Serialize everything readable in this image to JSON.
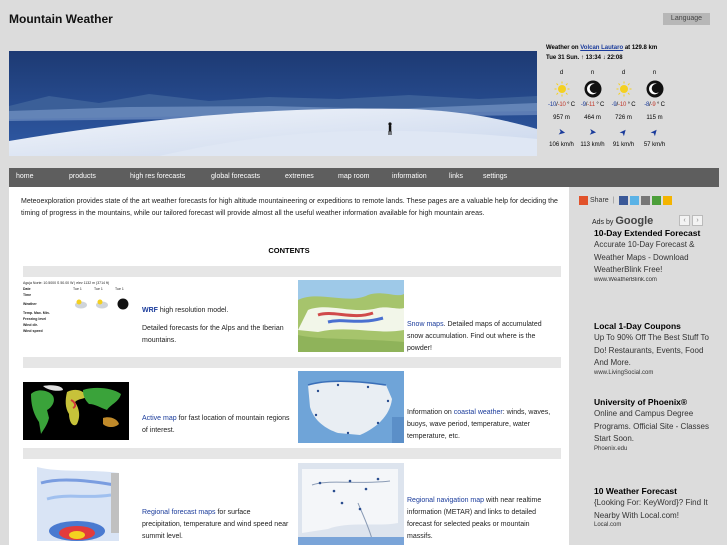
{
  "header": {
    "site_title": "Mountain Weather",
    "language_button": "Language"
  },
  "weather": {
    "title_prefix": "Weather on",
    "location": "Volcan Lautaro",
    "distance": "at 129.8 km",
    "date_line": "Tue 31  Sun. ↑ 13:34 ↓ 22:08",
    "columns": [
      {
        "period": "d",
        "icon": "sun-icon",
        "t_lo": "-10",
        "t_hi": "-10",
        "unit": "° C",
        "alt": "957 m",
        "wind": "106 km/h",
        "arrow": "➤"
      },
      {
        "period": "n",
        "icon": "moon-icon",
        "t_lo": "-9",
        "t_hi": "-11",
        "unit": "° C",
        "alt": "464 m",
        "wind": "113 km/h",
        "arrow": "➤"
      },
      {
        "period": "d",
        "icon": "sun-icon",
        "t_lo": "-9",
        "t_hi": "-10",
        "unit": "° C",
        "alt": "726 m",
        "wind": "91 km/h",
        "arrow": "➤"
      },
      {
        "period": "n",
        "icon": "moon-icon",
        "t_lo": "-8",
        "t_hi": "-9",
        "unit": "° C",
        "alt": "115 m",
        "wind": "57 km/h",
        "arrow": "➤"
      }
    ]
  },
  "nav": {
    "items": [
      "home",
      "products",
      "high res forecasts",
      "global forecasts",
      "extremes",
      "map room",
      "information",
      "links",
      "settings"
    ]
  },
  "main": {
    "intro": "Meteoexploration provides state of the art weather forecasts for high altitude mountaineering or expeditions to remote lands. These pages are a valuable help for deciding the timing of progress in the mountains, while our tailored forecast will provide almost all the useful weather information available for high mountain areas.",
    "contents_heading": "CONTENTS",
    "wrf_table": {
      "header": "Aguja Norte: 10.5000 S 50.00 W | elev 1132 m (3714 ft)",
      "date_label": "Date",
      "time_label": "Time",
      "weather_label": "Weather",
      "temp_label": "Temp. Max. Min.",
      "pressure_label": "Freezing level",
      "wind_dir_label": "Wind dir.",
      "wind_speed_label": "Wind speed",
      "cols": [
        "Tue 1",
        "Tue 1",
        "Tue 1"
      ]
    },
    "items": [
      {
        "link": "WRF",
        "text_after_link": " high resolution model.",
        "text2": "Detailed forecasts for the Alps and the Iberian mountains."
      },
      {
        "link": "Snow maps",
        "text_after_link": ". Detailed maps of accumulated snow accumulation. Find out where is the powder!"
      },
      {
        "link": "Active map",
        "text_after_link": " for fast location of mountain regions of interest."
      },
      {
        "text_before_link": "Information on ",
        "link": "coastal weather",
        "text_after_link": ": winds, waves, buoys, wave period, temperature, water temperature, etc."
      },
      {
        "link": "Regional forecast maps",
        "text_after_link": " for surface precipitation, temperature and wind speed near summit level."
      },
      {
        "link": "Regional navigation map",
        "text_after_link": " with near realtime information (METAR) and links to detailed forecast for selected peaks or mountain massifs."
      }
    ]
  },
  "sidebar": {
    "share_label": "Share",
    "ads_by": "Ads by",
    "ads_brand": "Google",
    "ads": [
      {
        "title": "10-Day Extended Forecast",
        "body": "Accurate 10-Day Forecast & Weather Maps - Download WeatherBlink Free!",
        "url": "www.WeatherBlink.com"
      },
      {
        "title": "Local 1-Day Coupons",
        "body": "Up To 90% Off The Best Stuff To Do! Restaurants, Events, Food And More.",
        "url": "www.LivingSocial.com"
      },
      {
        "title": "University of Phoenix®",
        "body": "Online and Campus Degree Programs. Official Site - Classes Start Soon.",
        "url": "Phoenix.edu"
      },
      {
        "title": "10 Weather Forecast",
        "body": "{Looking For: KeyWord}? Find It Nearby With Local.com!",
        "url": "Local.com"
      }
    ]
  },
  "colors": {
    "link": "#1a3b9b",
    "nav_bg": "#5e5e5e",
    "page_bg": "#dcdcdc"
  }
}
